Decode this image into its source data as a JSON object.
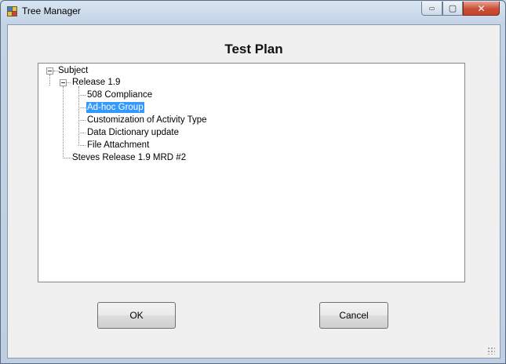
{
  "window": {
    "title": "Tree Manager",
    "controls": {
      "minimize": "▭",
      "maximize": "▢",
      "close": "✕"
    }
  },
  "heading": "Test Plan",
  "tree": {
    "root": "Subject",
    "release": "Release 1.9",
    "items": [
      "508 Compliance",
      "Ad-hoc Group",
      "Customization of Activity Type",
      "Data Dictionary update",
      "File Attachment"
    ],
    "selected": "Ad-hoc Group",
    "sibling": "Steves Release 1.9 MRD #2"
  },
  "buttons": {
    "ok": "OK",
    "cancel": "Cancel"
  },
  "icons": {
    "app": "tree-app-icon",
    "expanded": "minus-expander-icon"
  },
  "colors": {
    "selection": "#3399ff",
    "close_button": "#c94e34"
  }
}
